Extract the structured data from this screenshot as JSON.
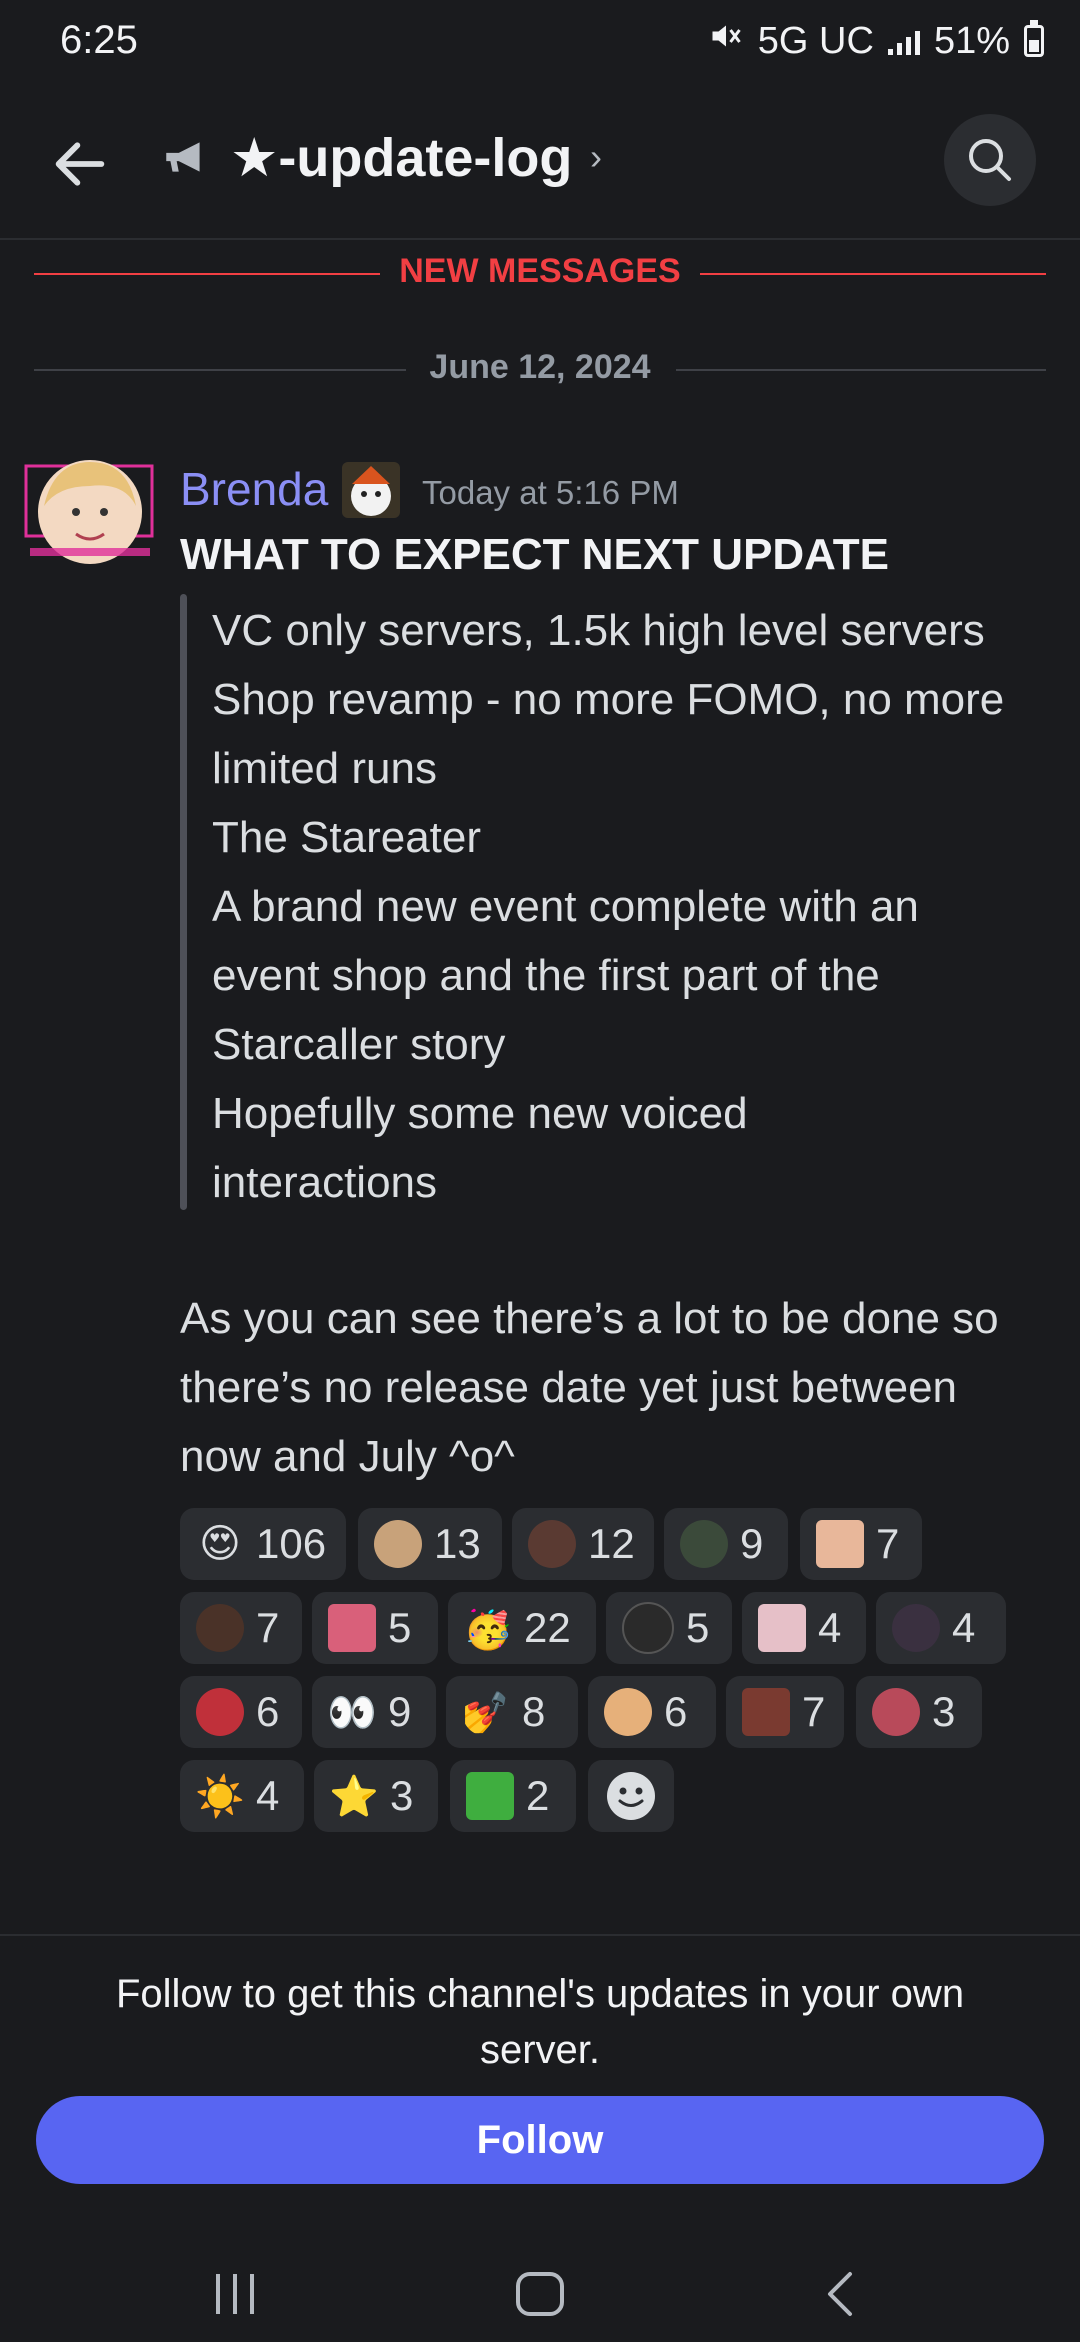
{
  "status_bar": {
    "time": "6:25",
    "network": "5G UC",
    "battery": "51%",
    "battery_level": 0.51,
    "icons": [
      "mute-icon",
      "signal-icon",
      "battery-icon"
    ]
  },
  "header": {
    "channel_name": "★-update-log",
    "chevron": "›",
    "icons": [
      "back-arrow-icon",
      "megaphone-icon",
      "search-icon"
    ]
  },
  "dividers": {
    "new_messages": "NEW MESSAGES",
    "date": "June 12, 2024"
  },
  "message": {
    "author": "Brenda",
    "timestamp": "Today at 5:16 PM",
    "heading": "WHAT TO EXPECT NEXT UPDATE",
    "quote_lines": [
      "VC only servers, 1.5k high level servers",
      "Shop revamp - no more FOMO, no more",
      "limited runs",
      "The Stareater",
      "A brand new event complete with an",
      "event shop and the first part of the",
      "Starcaller story",
      "Hopefully some new voiced",
      "interactions"
    ],
    "body_lines": [
      "As you can see there’s a lot to be done so",
      "there’s no release date yet just between",
      "now and July ^o^"
    ]
  },
  "reactions": [
    {
      "emoji": "😍",
      "count": "106"
    },
    {
      "emoji": "custom-emoji",
      "count": "13"
    },
    {
      "emoji": "custom-emoji",
      "count": "12"
    },
    {
      "emoji": "custom-emoji",
      "count": "9"
    },
    {
      "emoji": "custom-emoji",
      "count": "7"
    },
    {
      "emoji": "custom-emoji",
      "count": "7"
    },
    {
      "emoji": "custom-emoji",
      "count": "5"
    },
    {
      "emoji": "🥳",
      "count": "22"
    },
    {
      "emoji": "custom-emoji",
      "count": "5"
    },
    {
      "emoji": "custom-emoji",
      "count": "4"
    },
    {
      "emoji": "custom-emoji",
      "count": "4"
    },
    {
      "emoji": "custom-emoji",
      "count": "6"
    },
    {
      "emoji": "👀",
      "count": "9"
    },
    {
      "emoji": "💅",
      "count": "8"
    },
    {
      "emoji": "custom-emoji",
      "count": "6"
    },
    {
      "emoji": "custom-emoji",
      "count": "7"
    },
    {
      "emoji": "custom-emoji",
      "count": "3"
    },
    {
      "emoji": "☀️",
      "count": "4"
    },
    {
      "emoji": "⭐",
      "count": "3"
    },
    {
      "emoji": "custom-emoji",
      "count": "2"
    }
  ],
  "footer": {
    "follow_text": "Follow to get this channel's updates in your own server.",
    "follow_button": "Follow"
  },
  "colors": {
    "background": "#1a1b1e",
    "author": "#8b8ff5",
    "new_messages": "#f23f43",
    "accent_button": "#5865f2"
  }
}
